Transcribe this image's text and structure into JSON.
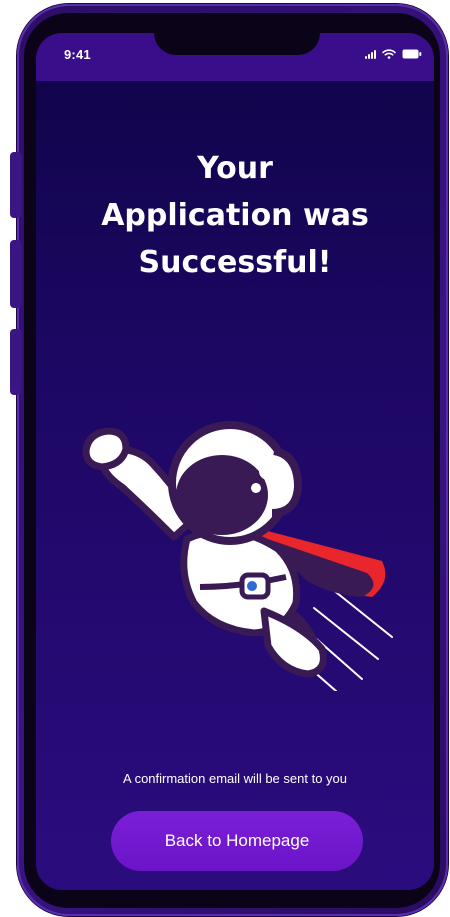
{
  "status_bar": {
    "time": "9:41"
  },
  "success_screen": {
    "title_lines": [
      "Your",
      "Application was",
      "Successful!"
    ],
    "illustration_label": "flying-astronaut",
    "confirmation_text": "A confirmation email will be sent to you",
    "home_button_label": "Back to Homepage"
  },
  "colors": {
    "background_top": "#0f0448",
    "background_bottom": "#2b0c7e",
    "status_bar": "#3a0e8a",
    "button": "#7a1fd7",
    "cape": "#e8262c"
  },
  "icons": [
    "signal-icon",
    "wifi-icon",
    "battery-icon"
  ]
}
